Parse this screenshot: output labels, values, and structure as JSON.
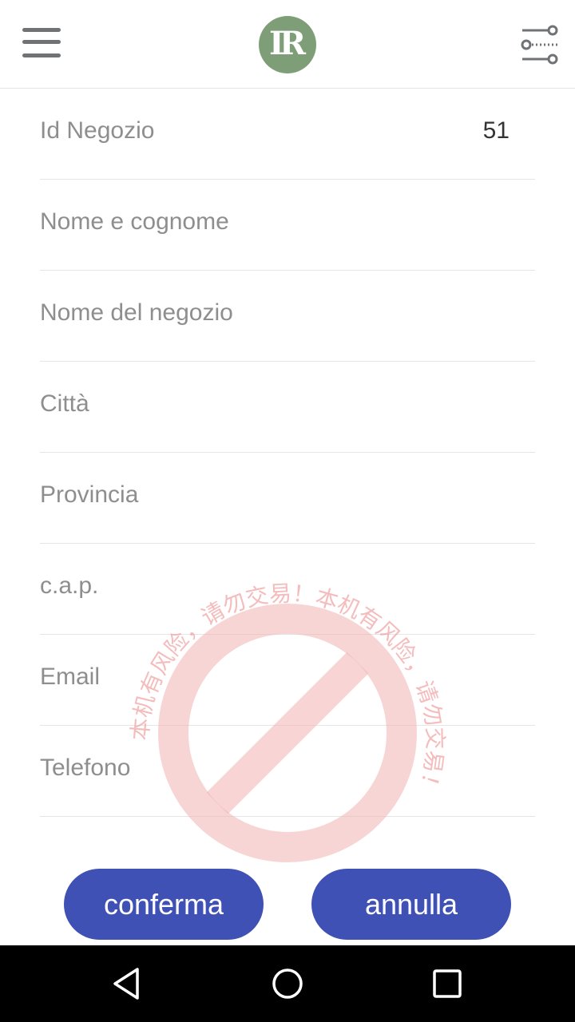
{
  "header": {
    "menu_icon": "hamburger-menu-icon",
    "logo_text": "IR",
    "logo_color": "#7e9e78",
    "filter_icon": "filter-settings-icon"
  },
  "form": {
    "store_id": {
      "label": "Id Negozio",
      "value": "51"
    },
    "full_name": {
      "label": "Nome e cognome",
      "value": ""
    },
    "store_name": {
      "label": "Nome del negozio",
      "value": ""
    },
    "city": {
      "label": "Città",
      "value": ""
    },
    "province": {
      "label": "Provincia",
      "value": ""
    },
    "zip": {
      "label": "c.a.p.",
      "value": ""
    },
    "email": {
      "label": "Email",
      "value": ""
    },
    "phone": {
      "label": "Telefono",
      "value": ""
    }
  },
  "actions": {
    "confirm_label": "conferma",
    "cancel_label": "annulla",
    "accent": "#3f51b5"
  },
  "watermark": {
    "text": "本机有风险，请勿交易！本机有风险，请勿交易！",
    "color": "#f0a0a0"
  },
  "navbar": {
    "back_icon": "back-triangle-icon",
    "home_icon": "home-circle-icon",
    "recent_icon": "recent-apps-square-icon"
  }
}
